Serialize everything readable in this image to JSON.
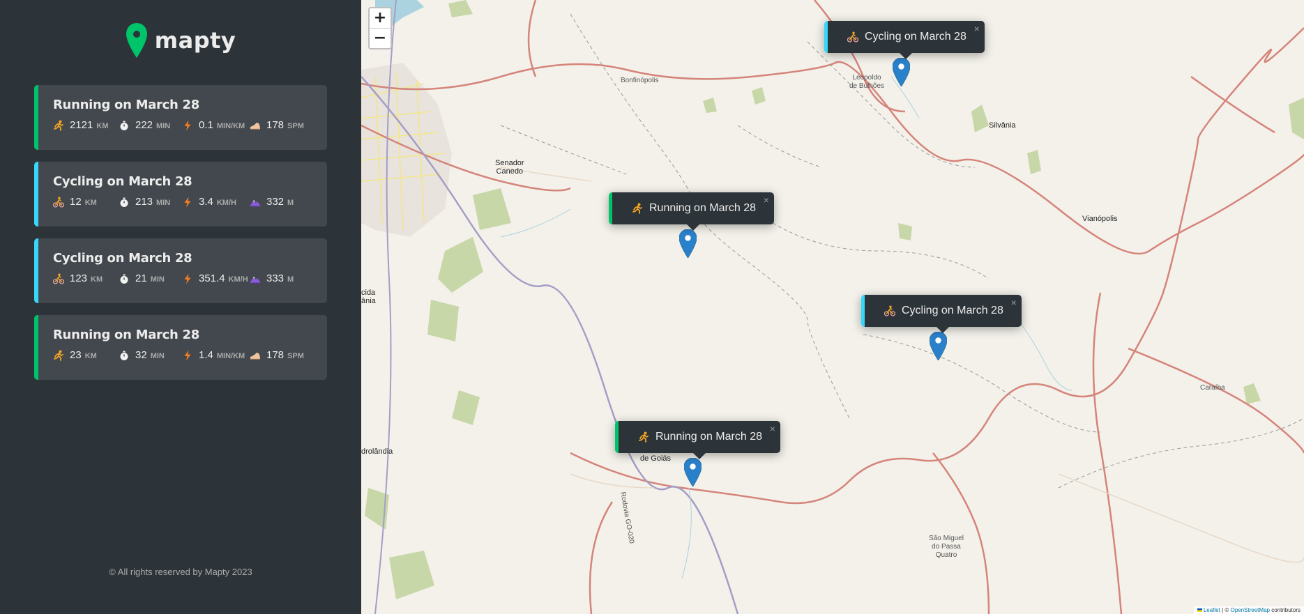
{
  "app": {
    "name": "mapty",
    "brand_color": "#00c46a",
    "cycling_color": "#36d7f8"
  },
  "workouts": [
    {
      "type": "running",
      "title": "Running on March 28",
      "distance": "2121",
      "distance_unit": "km",
      "duration": "222",
      "duration_unit": "min",
      "speed": "0.1",
      "speed_unit": "min/km",
      "extra": "178",
      "extra_unit": "spm"
    },
    {
      "type": "cycling",
      "title": "Cycling on March 28",
      "distance": "12",
      "distance_unit": "km",
      "duration": "213",
      "duration_unit": "min",
      "speed": "3.4",
      "speed_unit": "km/h",
      "extra": "332",
      "extra_unit": "m"
    },
    {
      "type": "cycling",
      "title": "Cycling on March 28",
      "distance": "123",
      "distance_unit": "km",
      "duration": "21",
      "duration_unit": "min",
      "speed": "351.4",
      "speed_unit": "km/h",
      "extra": "333",
      "extra_unit": "m"
    },
    {
      "type": "running",
      "title": "Running on March 28",
      "distance": "23",
      "distance_unit": "km",
      "duration": "32",
      "duration_unit": "min",
      "speed": "1.4",
      "speed_unit": "min/km",
      "extra": "178",
      "extra_unit": "spm"
    }
  ],
  "copyright": "© All rights reserved by Mapty 2023",
  "map": {
    "zoom_in": "+",
    "zoom_out": "−",
    "popups": [
      {
        "type": "cycling",
        "label": "Cycling on March 28",
        "close": "×"
      },
      {
        "type": "running",
        "label": "Running on March 28",
        "close": "×"
      },
      {
        "type": "cycling",
        "label": "Cycling on March 28",
        "close": "×"
      },
      {
        "type": "running",
        "label": "Running on March 28",
        "close": "×"
      }
    ],
    "places": {
      "bonfinopolis": "Bonfinópolis",
      "leopoldo": "Leopoldo\nde Bulhões",
      "silvania": "Silvânia",
      "senador": "Senador\nCanedo",
      "vianopolis": "Vianópolis",
      "caraiba": "Caraíba",
      "sao_miguel": "São Miguel\ndo Passa\nQuatro",
      "de_goias": "de Goiás",
      "rodovia": "Rodovia GO-020",
      "aparecida": "cida\nânia",
      "hidrolandia": "drolândia"
    },
    "attribution": {
      "leaflet": "Leaflet",
      "sep": " | © ",
      "osm": "OpenStreetMap",
      "suffix": " contributors"
    }
  }
}
